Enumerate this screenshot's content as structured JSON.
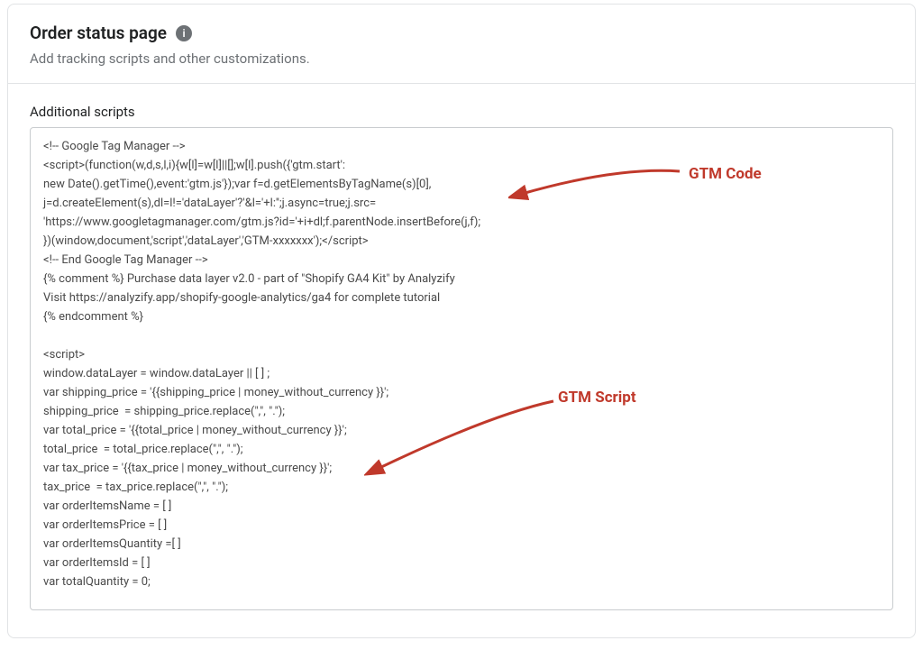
{
  "header": {
    "title": "Order status page",
    "info_glyph": "i",
    "subtitle": "Add tracking scripts and other customizations."
  },
  "section": {
    "label": "Additional scripts",
    "code": "<!-- Google Tag Manager -->\n<script>(function(w,d,s,l,i){w[l]=w[l]||[];w[l].push({'gtm.start':\nnew Date().getTime(),event:'gtm.js'});var f=d.getElementsByTagName(s)[0],\nj=d.createElement(s),dl=l!='dataLayer'?'&l='+l:'';j.async=true;j.src=\n'https://www.googletagmanager.com/gtm.js?id='+i+dl;f.parentNode.insertBefore(j,f);\n})(window,document,'script','dataLayer','GTM-xxxxxxx');</script>\n<!-- End Google Tag Manager -->\n{% comment %} Purchase data layer v2.0 - part of \"Shopify GA4 Kit\" by Analyzify\nVisit https://analyzify.app/shopify-google-analytics/ga4 for complete tutorial\n{% endcomment %}\n\n<script>\nwindow.dataLayer = window.dataLayer || [ ] ;\nvar shipping_price = '{{shipping_price | money_without_currency }}';\nshipping_price  = shipping_price.replace(\",\", \".\");\nvar total_price = '{{total_price | money_without_currency }}';\ntotal_price  = total_price.replace(\",\", \".\");\nvar tax_price = '{{tax_price | money_without_currency }}';\ntax_price  = tax_price.replace(\",\", \".\");\nvar orderItemsName = [ ]\nvar orderItemsPrice = [ ]\nvar orderItemsQuantity =[ ]\nvar orderItemsId = [ ]\nvar totalQuantity = 0;"
  },
  "annotations": {
    "gtm_code": "GTM Code",
    "gtm_script": "GTM Script"
  }
}
